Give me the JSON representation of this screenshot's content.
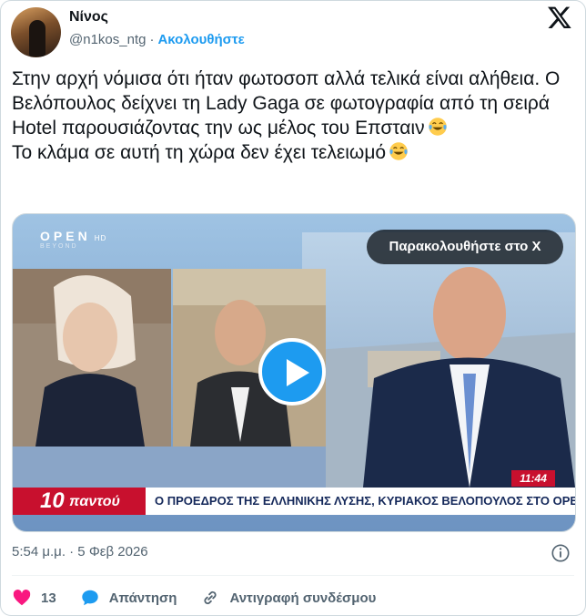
{
  "post": {
    "author_name": "Νίνος",
    "handle": "@n1kos_ntg",
    "separator": "·",
    "follow_label": "Ακολουθήστε",
    "text_lines": [
      "Στην αρχή νόμισα ότι ήταν φωτοσοπ αλλά τελικά είναι αλήθεια. Ο Βελόπουλος δείχνει τη Lady Gaga σε φωτογραφία από τη σειρά Hotel παρουσιάζοντας την ως μέλος του Επσταιν",
      "Το κλάμα σε αυτή τη χώρα δεν έχει τελειωμό"
    ],
    "emoji": "face-with-tears-of-joy",
    "timestamp": "5:54 μ.μ. · 5 Φεβ 2026"
  },
  "media": {
    "watch_label": "Παρακολουθήστε στο X",
    "channel_logo": "OPEN",
    "channel_logo_suffix": "HD",
    "channel_logo_sub": "BEYOND",
    "clock": "11:44",
    "banner_number": "10",
    "banner_tag": "παντού",
    "headline": "Ο ΠΡΟΕΔΡΟΣ ΤΗΣ ΕΛΛΗΝΙΚΗΣ ΛΥΣΗΣ, ΚΥΡΙΑΚΟΣ ΒΕΛΟΠΟΥΛΟΣ ΣΤΟ OPEN"
  },
  "actions": {
    "like_count": "13",
    "reply_label": "Απάντηση",
    "copy_link_label": "Αντιγραφή συνδέσμου"
  },
  "colors": {
    "accent": "#1d9bf0",
    "like": "#f91880",
    "banner_red": "#c8102e",
    "banner_navy": "#14285a"
  }
}
